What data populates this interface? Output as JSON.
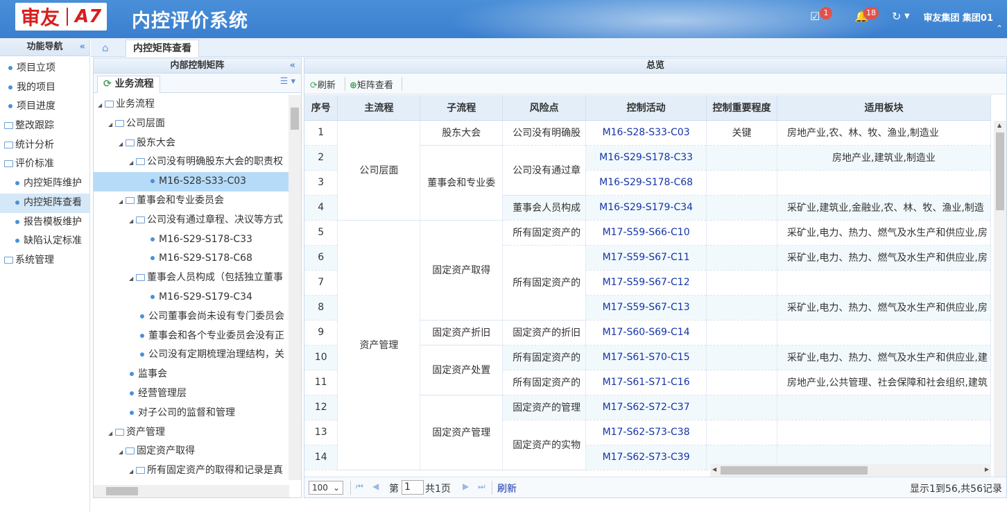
{
  "header": {
    "brand": "审友",
    "product": "A7",
    "title": "内控评价系统",
    "tasks_badge": "1",
    "notifications_badge": "18",
    "org": "审友集团  集团01"
  },
  "left_nav": {
    "title": "功能导航",
    "items": [
      {
        "label": "项目立项",
        "kind": "leaf"
      },
      {
        "label": "我的项目",
        "kind": "leaf"
      },
      {
        "label": "项目进度",
        "kind": "leaf"
      },
      {
        "label": "整改跟踪",
        "kind": "folder"
      },
      {
        "label": "统计分析",
        "kind": "folder"
      },
      {
        "label": "评价标准",
        "kind": "folder"
      },
      {
        "label": "内控矩阵维护",
        "kind": "leaf2"
      },
      {
        "label": "内控矩阵查看",
        "kind": "leaf2",
        "selected": true
      },
      {
        "label": "报告模板维护",
        "kind": "leaf2"
      },
      {
        "label": "缺陷认定标准",
        "kind": "leaf2"
      },
      {
        "label": "系统管理",
        "kind": "folder"
      }
    ]
  },
  "tabs": {
    "active": "内控矩阵查看"
  },
  "tree_panel": {
    "title": "内部控制矩阵",
    "tab": "业务流程",
    "nodes": [
      {
        "label": "业务流程",
        "indent": 0,
        "type": "folder-open"
      },
      {
        "label": "公司层面",
        "indent": 1,
        "type": "folder-open"
      },
      {
        "label": "股东大会",
        "indent": 2,
        "type": "folder-open"
      },
      {
        "label": "公司没有明确股东大会的职责权",
        "indent": 3,
        "type": "folder-open"
      },
      {
        "label": "M16-S28-S33-C03",
        "indent": 4,
        "type": "leaf",
        "selected": true
      },
      {
        "label": "董事会和专业委员会",
        "indent": 2,
        "type": "folder-open"
      },
      {
        "label": "公司没有通过章程、决议等方式",
        "indent": 3,
        "type": "folder-open"
      },
      {
        "label": "M16-S29-S178-C33",
        "indent": 4,
        "type": "leaf"
      },
      {
        "label": "M16-S29-S178-C68",
        "indent": 4,
        "type": "leaf"
      },
      {
        "label": "董事会人员构成（包括独立董事",
        "indent": 3,
        "type": "folder-open"
      },
      {
        "label": "M16-S29-S179-C34",
        "indent": 4,
        "type": "leaf"
      },
      {
        "label": "公司董事会尚未设有专门委员会",
        "indent": 3,
        "type": "leaf"
      },
      {
        "label": "董事会和各个专业委员会没有正",
        "indent": 3,
        "type": "leaf"
      },
      {
        "label": "公司没有定期梳理治理结构，关",
        "indent": 3,
        "type": "leaf"
      },
      {
        "label": "监事会",
        "indent": 2,
        "type": "leaf"
      },
      {
        "label": "经营管理层",
        "indent": 2,
        "type": "leaf"
      },
      {
        "label": "对子公司的监督和管理",
        "indent": 2,
        "type": "leaf"
      },
      {
        "label": "资产管理",
        "indent": 1,
        "type": "folder-open"
      },
      {
        "label": "固定资产取得",
        "indent": 2,
        "type": "folder-open"
      },
      {
        "label": "所有固定资产的取得和记录是真",
        "indent": 3,
        "type": "folder-open"
      }
    ]
  },
  "main_panel": {
    "title": "总览",
    "toolbar": {
      "refresh": "刷新",
      "matrix_view": "矩阵查看"
    },
    "columns": [
      "序号",
      "主流程",
      "子流程",
      "风险点",
      "控制活动",
      "控制重要程度",
      "适用板块"
    ],
    "rows": [
      {
        "no": "1",
        "main": "公司层面",
        "sub": "股东大会",
        "risk": "公司没有明确股",
        "control": "M16-S28-S33-C03",
        "importance": "关键",
        "sector": "房地产业,农、林、牧、渔业,制造业"
      },
      {
        "no": "2",
        "main": "",
        "sub": "董事会和专业委",
        "risk": "公司没有通过章",
        "control": "M16-S29-S178-C33",
        "importance": "",
        "sector": "房地产业,建筑业,制造业"
      },
      {
        "no": "3",
        "main": "",
        "sub": "",
        "risk": "",
        "control": "M16-S29-S178-C68",
        "importance": "",
        "sector": ""
      },
      {
        "no": "4",
        "main": "",
        "sub": "",
        "risk": "董事会人员构成",
        "control": "M16-S29-S179-C34",
        "importance": "",
        "sector": "采矿业,建筑业,金融业,农、林、牧、渔业,制造"
      },
      {
        "no": "5",
        "main": "资产管理",
        "sub": "固定资产取得",
        "risk": "所有固定资产的",
        "control": "M17-S59-S66-C10",
        "importance": "",
        "sector": "采矿业,电力、热力、燃气及水生产和供应业,房"
      },
      {
        "no": "6",
        "main": "",
        "sub": "",
        "risk": "所有固定资产的",
        "control": "M17-S59-S67-C11",
        "importance": "",
        "sector": "采矿业,电力、热力、燃气及水生产和供应业,房"
      },
      {
        "no": "7",
        "main": "",
        "sub": "",
        "risk": "",
        "control": "M17-S59-S67-C12",
        "importance": "",
        "sector": ""
      },
      {
        "no": "8",
        "main": "",
        "sub": "",
        "risk": "",
        "control": "M17-S59-S67-C13",
        "importance": "",
        "sector": "采矿业,电力、热力、燃气及水生产和供应业,房"
      },
      {
        "no": "9",
        "main": "",
        "sub": "固定资产折旧",
        "risk": "固定资产的折旧",
        "control": "M17-S60-S69-C14",
        "importance": "",
        "sector": ""
      },
      {
        "no": "10",
        "main": "",
        "sub": "固定资产处置",
        "risk": "所有固定资产的",
        "control": "M17-S61-S70-C15",
        "importance": "",
        "sector": "采矿业,电力、热力、燃气及水生产和供应业,建"
      },
      {
        "no": "11",
        "main": "",
        "sub": "",
        "risk": "所有固定资产的",
        "control": "M17-S61-S71-C16",
        "importance": "",
        "sector": "房地产业,公共管理、社会保障和社会组织,建筑"
      },
      {
        "no": "12",
        "main": "",
        "sub": "固定资产管理",
        "risk": "固定资产的管理",
        "control": "M17-S62-S72-C37",
        "importance": "",
        "sector": ""
      },
      {
        "no": "13",
        "main": "",
        "sub": "",
        "risk": "固定资产的实物",
        "control": "M17-S62-S73-C38",
        "importance": "",
        "sector": ""
      },
      {
        "no": "14",
        "main": "",
        "sub": "",
        "risk": "",
        "control": "M17-S62-S73-C39",
        "importance": "",
        "sector": ""
      }
    ],
    "pager": {
      "page_size": "100",
      "page_label": "第",
      "page": "1",
      "total_pages": "共1页",
      "refresh": "刷新",
      "summary": "显示1到56,共56记录"
    }
  }
}
